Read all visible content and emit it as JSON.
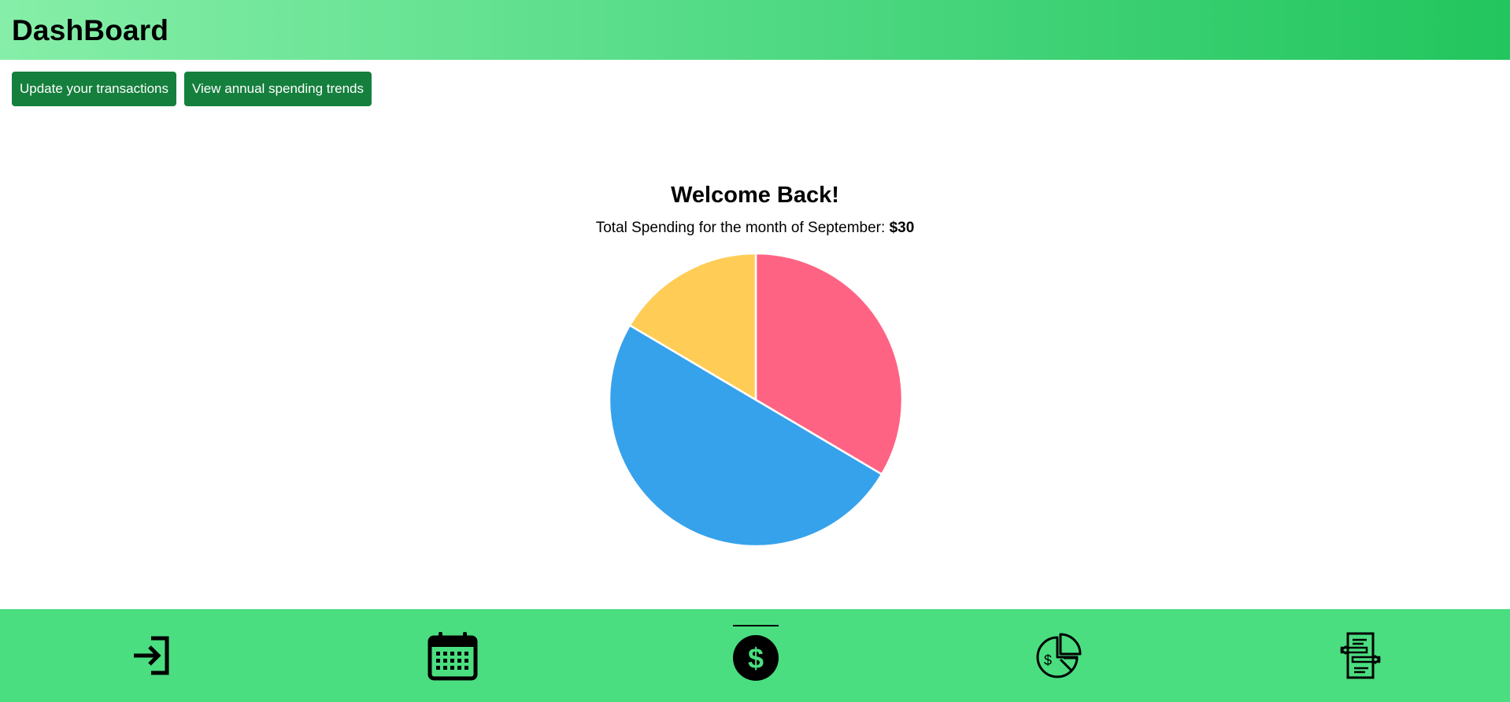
{
  "header": {
    "title": "DashBoard"
  },
  "toolbar": {
    "update_label": "Update your transactions",
    "trends_label": "View annual spending trends"
  },
  "main": {
    "welcome": "Welcome Back!",
    "spending_text": "Total Spending for the month of September: ",
    "spending_amount": "$30"
  },
  "chart_data": {
    "type": "pie",
    "values": [
      33.5,
      50,
      16.5
    ],
    "colors": [
      "#ff6384",
      "#36a2eb",
      "#ffcd56"
    ],
    "title": ""
  },
  "bottom_nav": {
    "items": [
      {
        "icon": "sign-in-icon",
        "active": false
      },
      {
        "icon": "calendar-icon",
        "active": false
      },
      {
        "icon": "dollar-circle-icon",
        "active": true
      },
      {
        "icon": "pie-chart-dollar-icon",
        "active": false
      },
      {
        "icon": "transfer-document-icon",
        "active": false
      }
    ]
  },
  "colors": {
    "header_start": "#86eea8",
    "header_end": "#22c55e",
    "button": "#157f3d",
    "footer": "#4ade80"
  }
}
